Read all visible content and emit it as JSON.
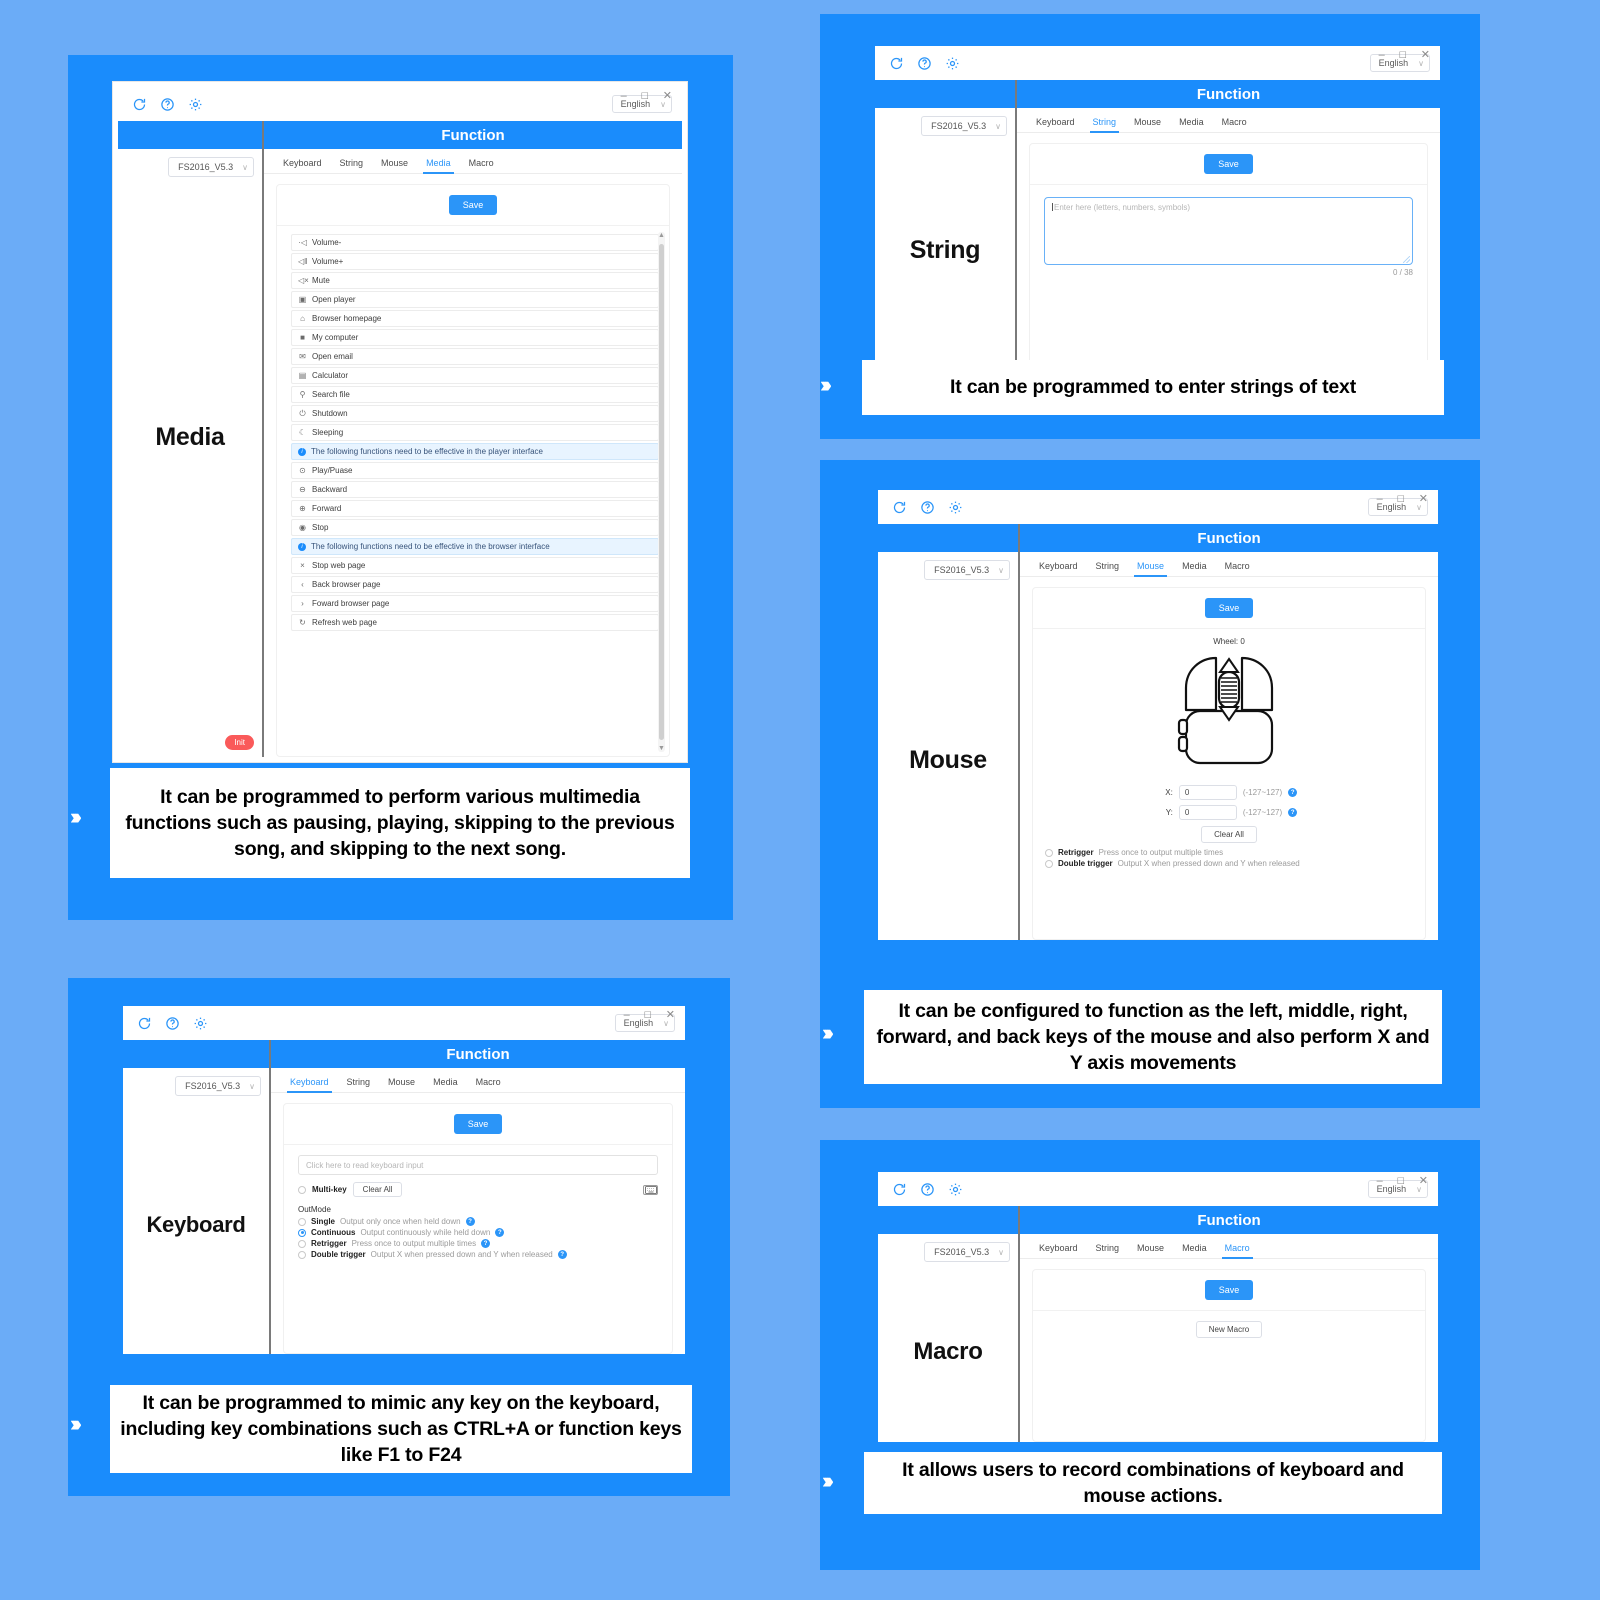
{
  "theme": {
    "bg": "#6bacf7",
    "card": "#1a8cfc",
    "accent": "#2b95f8",
    "init_red": "#fa5a5a"
  },
  "app": {
    "window_buttons": {
      "minimize": "–",
      "maximize": "❐",
      "close": "✕"
    },
    "language": {
      "value": "English",
      "chevron": "∨"
    },
    "device": {
      "value": "FS2016_V5.3",
      "chevron": "∨"
    },
    "function_title": "Function",
    "tabs": [
      "Keyboard",
      "String",
      "Mouse",
      "Media",
      "Macro"
    ],
    "save_label": "Save",
    "icons": [
      "refresh-icon",
      "help-icon",
      "gear-icon"
    ]
  },
  "panels": [
    {
      "id": "media",
      "big_title": "Media",
      "active_tab": "Media",
      "init_label": "Init",
      "caption": "It can be programmed to perform various multimedia functions such as pausing, playing, skipping to the previous song, and skipping to the next song.",
      "list": [
        {
          "icon": "·◁",
          "label": "Volume-",
          "type": "item"
        },
        {
          "icon": "◁‖",
          "label": "Volume+",
          "type": "item"
        },
        {
          "icon": "◁×",
          "label": "Mute",
          "type": "item"
        },
        {
          "icon": "▣",
          "label": "Open player",
          "type": "item"
        },
        {
          "icon": "⌂",
          "label": "Browser homepage",
          "type": "item"
        },
        {
          "icon": "■",
          "label": "My computer",
          "type": "item"
        },
        {
          "icon": "✉",
          "label": "Open email",
          "type": "item"
        },
        {
          "icon": "▤",
          "label": "Calculator",
          "type": "item"
        },
        {
          "icon": "⚲",
          "label": "Search file",
          "type": "item"
        },
        {
          "icon": "⏻",
          "label": "Shutdown",
          "type": "item"
        },
        {
          "icon": "☾",
          "label": "Sleeping",
          "type": "item"
        },
        {
          "icon": "",
          "label": "The following functions need to be effective in the player interface",
          "type": "note"
        },
        {
          "icon": "⊙",
          "label": "Play/Puase",
          "type": "item"
        },
        {
          "icon": "⊖",
          "label": "Backward",
          "type": "item"
        },
        {
          "icon": "⊕",
          "label": "Forward",
          "type": "item"
        },
        {
          "icon": "◉",
          "label": "Stop",
          "type": "item"
        },
        {
          "icon": "",
          "label": "The following functions need to be effective in the browser interface",
          "type": "note"
        },
        {
          "icon": "×",
          "label": "Stop web page",
          "type": "item"
        },
        {
          "icon": "‹",
          "label": "Back browser page",
          "type": "item"
        },
        {
          "icon": "›",
          "label": "Foward browser page",
          "type": "item"
        },
        {
          "icon": "↻",
          "label": "Refresh web page",
          "type": "item"
        }
      ]
    },
    {
      "id": "string",
      "big_title": "String",
      "active_tab": "String",
      "caption": "It can be programmed to enter strings of text",
      "textarea_placeholder": "Enter here (letters, numbers, symbols)",
      "counter": "0 / 38"
    },
    {
      "id": "mouse",
      "big_title": "Mouse",
      "active_tab": "Mouse",
      "caption": "It can be configured to function as the left, middle, right, forward, and back keys of the mouse and also perform X and Y axis movements",
      "wheel_label": "Wheel: 0",
      "x_label": "X:",
      "x_value": "0",
      "x_range": "(-127~127)",
      "y_label": "Y:",
      "y_value": "0",
      "y_range": "(-127~127)",
      "clear_all": "Clear All",
      "options": [
        {
          "name": "Retrigger",
          "desc": "Press once to output multiple times",
          "selected": false
        },
        {
          "name": "Double trigger",
          "desc": "Output X when pressed down and Y when released",
          "selected": false
        }
      ]
    },
    {
      "id": "keyboard",
      "big_title": "Keyboard",
      "active_tab": "Keyboard",
      "caption": "It can be programmed to mimic any key on the keyboard, including key combinations such as CTRL+A or function keys like F1 to F24",
      "input_placeholder": "Click here to read keyboard input",
      "multikey_label": "Multi-key",
      "clear_all": "Clear All",
      "outmode_label": "OutMode",
      "options": [
        {
          "name": "Single",
          "desc": "Output only once when held down",
          "selected": false
        },
        {
          "name": "Continuous",
          "desc": "Output continuously while held down",
          "selected": true
        },
        {
          "name": "Retrigger",
          "desc": "Press once to output multiple times",
          "selected": false
        },
        {
          "name": "Double trigger",
          "desc": "Output X when pressed down and Y when released",
          "selected": false
        }
      ]
    },
    {
      "id": "macro",
      "big_title": "Macro",
      "active_tab": "Macro",
      "caption": "It allows users to record combinations of keyboard and mouse actions.",
      "new_macro": "New Macro"
    }
  ],
  "caption_chevrons": "›››"
}
